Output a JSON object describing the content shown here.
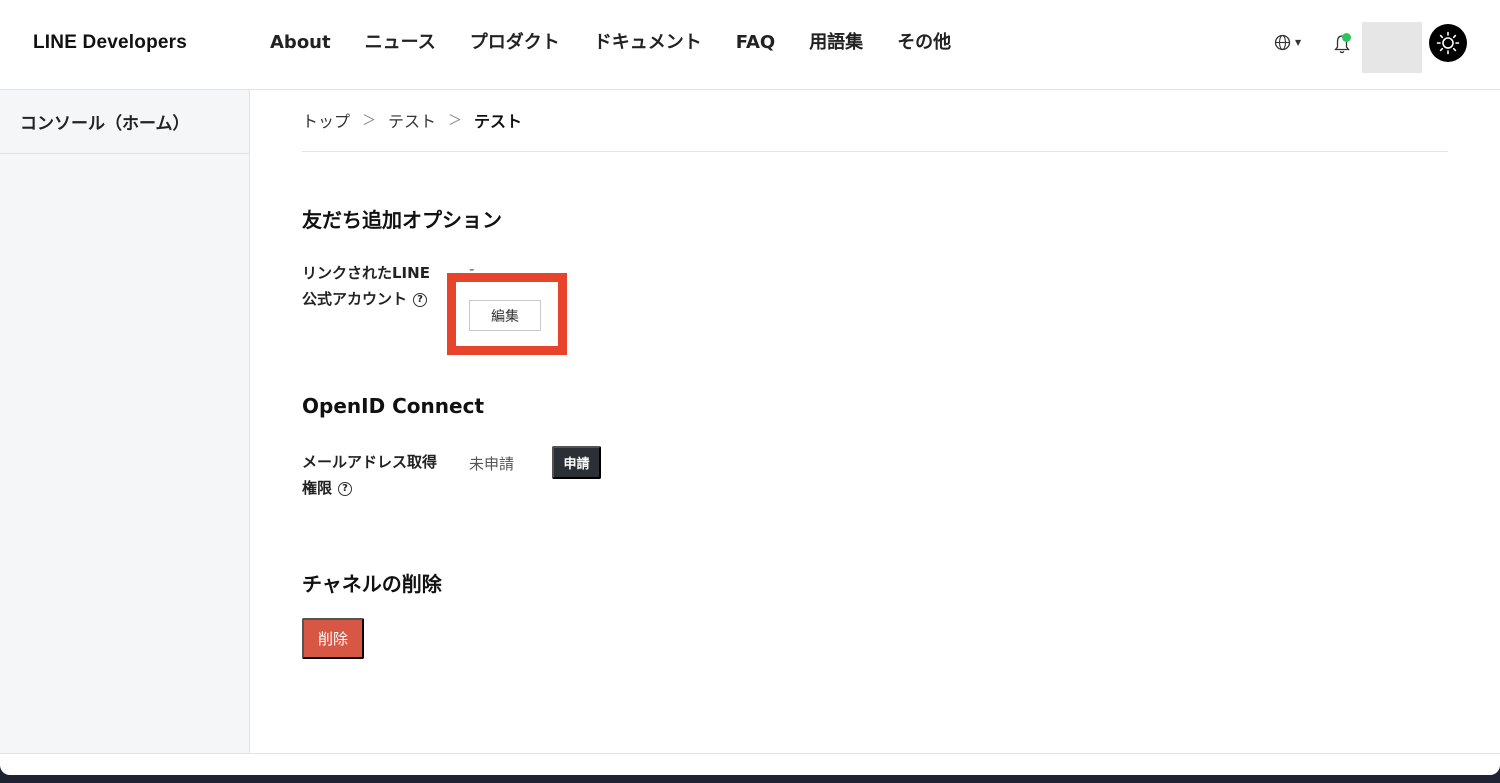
{
  "header": {
    "logo": "LINE Developers",
    "nav": [
      "About",
      "ニュース",
      "プロダクト",
      "ドキュメント",
      "FAQ",
      "用語集",
      "その他"
    ],
    "icons": [
      "globe-icon",
      "bell-icon",
      "sun-icon"
    ],
    "notification_dot_color": "#2fc35f"
  },
  "sidebar": {
    "items": [
      {
        "label": "コンソール（ホーム）"
      }
    ]
  },
  "breadcrumb": {
    "items": [
      "トップ",
      "テスト",
      "テスト"
    ]
  },
  "friend_option": {
    "title": "友だち追加オプション",
    "linked_label_line1": "リンクされたLINE",
    "linked_label_line2": "公式アカウント",
    "linked_value": "-",
    "edit_label": "編集",
    "highlight_color": "#e8432b"
  },
  "openid": {
    "title": "OpenID Connect",
    "email_label_line1": "メールアドレス取得",
    "email_label_line2": "権限",
    "email_status": "未申請",
    "apply_label": "申請"
  },
  "delete_section": {
    "title": "チャネルの削除",
    "delete_label": "削除",
    "delete_color": "#d85744"
  },
  "help_glyph": "?"
}
